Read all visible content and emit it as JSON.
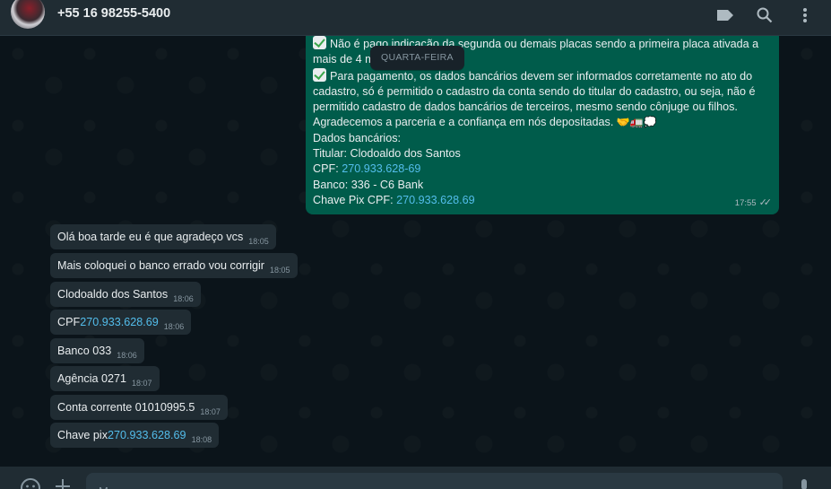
{
  "header": {
    "contact_name": "+55 16 98255-5400",
    "icons": [
      "label-icon",
      "search-icon",
      "menu-icon"
    ]
  },
  "outgoing": {
    "lines": {
      "l1": "Não é pago indicação da segunda ou demais placas sendo a primeira placa ativada a",
      "l2": "mais de 4 m",
      "l3": "Para pagamento, os dados bancários devem ser informados corretamente no ato do",
      "l4": "cadastro, só é permitido o cadastro da conta sendo do titular do cadastro, ou seja, não é",
      "l5": "permitido cadastro de dados bancários de terceiros, mesmo sendo cônjuge ou filhos.",
      "l6": "Agradecemos a parceria e a confiança em nós depositadas.",
      "l6_emoji": "🤝🚛💭",
      "l7": "Dados bancários:",
      "l8": "Titular: Clodoaldo dos Santos",
      "l9_label": "CPF: ",
      "l9_value": "270.933.628-69",
      "l10": "Banco: 336 - C6 Bank",
      "l11_label": "Chave Pix CPF: ",
      "l11_value": "270.933.628.69"
    },
    "time": "17:55",
    "ticks": "✓✓"
  },
  "day_chip": "QUARTA-FEIRA",
  "incoming": [
    {
      "text": "Olá boa tarde eu é que agradeço vcs",
      "link": "",
      "time": "18:05"
    },
    {
      "text": "Mais coloquei o banco errado vou corrigir",
      "link": "",
      "time": "18:05"
    },
    {
      "text": "Clodoaldo dos Santos",
      "link": "",
      "time": "18:06"
    },
    {
      "text": "CPF ",
      "link": "270.933.628.69",
      "time": "18:06"
    },
    {
      "text": "Banco 033",
      "link": "",
      "time": "18:06"
    },
    {
      "text": "Agência 0271",
      "link": "",
      "time": "18:07"
    },
    {
      "text": "Conta corrente 01010995.5",
      "link": "",
      "time": "18:07"
    },
    {
      "text": "Chave pix ",
      "link": "270.933.628.69",
      "time": "18:08"
    }
  ],
  "footer": {
    "placeholder": "Mensagem",
    "icons": [
      "emoji-icon",
      "plus-icon",
      "microphone-icon"
    ]
  },
  "colors": {
    "outgoing_bubble": "#005c4b",
    "incoming_bubble": "#202c33",
    "link": "#53bdeb",
    "background": "#0b141a"
  }
}
